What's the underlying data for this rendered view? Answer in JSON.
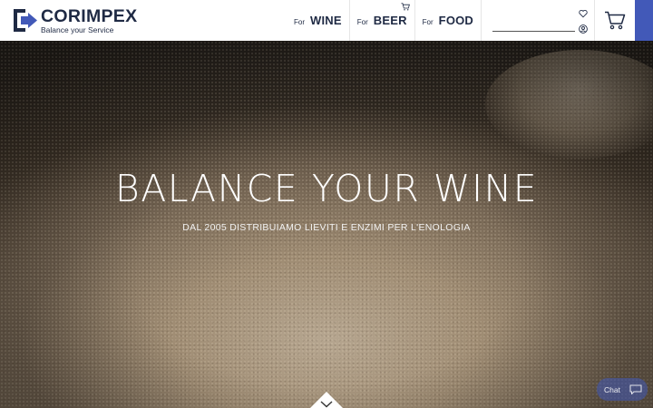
{
  "brand": {
    "name": "CORIMPEX",
    "tagline": "Balance your Service",
    "color": "#1f2a44"
  },
  "nav": {
    "items": [
      {
        "prefix": "For",
        "label": "WINE"
      },
      {
        "prefix": "For",
        "label": "BEER"
      },
      {
        "prefix": "For",
        "label": "FOOD"
      }
    ]
  },
  "search": {
    "value": "",
    "placeholder": ""
  },
  "icons": {
    "logo": "corimpex-arrow-logo",
    "heart": "heart-icon",
    "user": "user-icon",
    "cart": "cart-icon",
    "scroll": "chevron-down-icon",
    "chat": "chat-bubble-icon"
  },
  "accent": "#4259b8",
  "hero": {
    "title": "BALANCE YOUR WINE",
    "subtitle": "DAL 2005 DISTRIBUIAMO LIEVITI E ENZIMI PER L'ENOLOGIA"
  },
  "chat": {
    "label": "Chat"
  }
}
